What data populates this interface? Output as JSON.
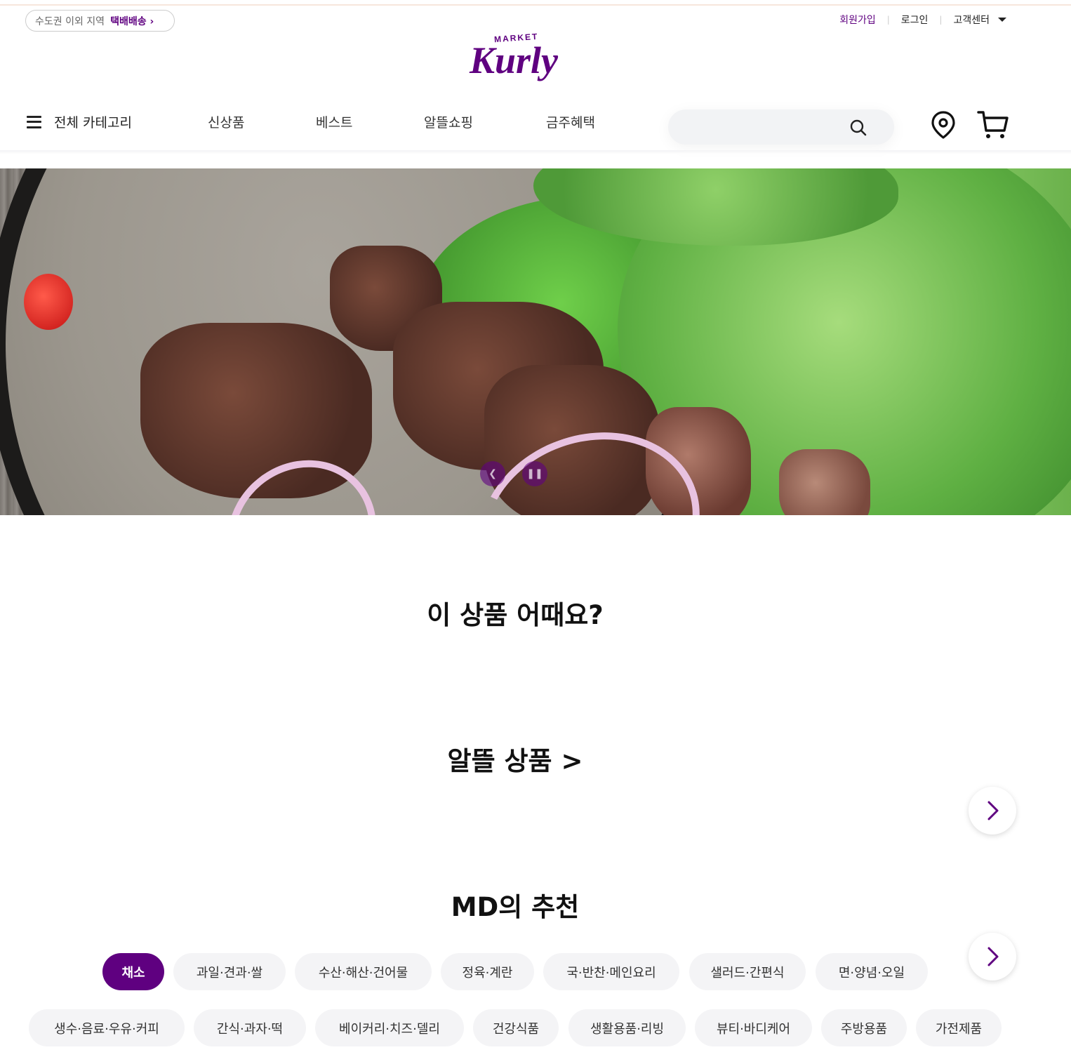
{
  "topbar": {
    "delivery_region": "수도권 이외 지역",
    "delivery_link": "택배배송 ›",
    "signup": "회원가입",
    "login": "로그인",
    "support": "고객센터"
  },
  "logo": {
    "top_text": "MARKET",
    "main_text": "Kurly",
    "brand_color": "#5f0080"
  },
  "nav": {
    "all_categories": "전체 카테고리",
    "items": [
      "신상품",
      "베스트",
      "알뜰쇼핑",
      "금주혜택"
    ],
    "search_placeholder": "",
    "icons": [
      "search-icon",
      "location-pin-icon",
      "cart-icon"
    ]
  },
  "hero": {
    "controls": [
      "prev",
      "pause"
    ],
    "image_alt": ""
  },
  "sections": {
    "recommend_title": "이 상품 어때요?",
    "thrifty_title": "알뜰 상품 >",
    "md_title": "MD의 추천"
  },
  "md_categories": {
    "row1": [
      "채소",
      "과일·견과·쌀",
      "수산·해산·건어물",
      "정육·계란",
      "국·반찬·메인요리",
      "샐러드·간편식",
      "면·양념·오일"
    ],
    "row2": [
      "생수·음료·우유·커피",
      "간식·과자·떡",
      "베이커리·치즈·델리",
      "건강식품",
      "생활용품·리빙",
      "뷰티·바디케어",
      "주방용품",
      "가전제품"
    ],
    "active": "채소"
  }
}
